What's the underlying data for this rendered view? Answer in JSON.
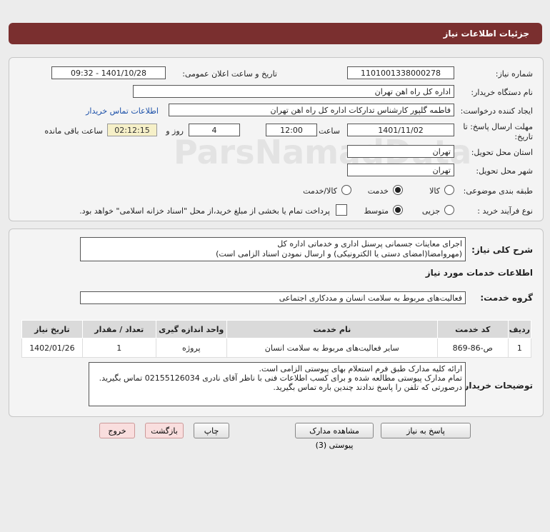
{
  "header": {
    "title": "جزئیات اطلاعات نیاز"
  },
  "form": {
    "need_number_label": "شماره نیاز:",
    "need_number": "1101001338000278",
    "announce_label": "تاریخ و ساعت اعلان عمومی:",
    "announce_value": "1401/10/28 - 09:32",
    "buyer_org_label": "نام دستگاه خریدار:",
    "buyer_org": "اداره کل راه اهن تهران",
    "creator_label": "ایجاد کننده درخواست:",
    "creator": "فاطمه گلپور کارشناس تدارکات اداره کل راه اهن تهران",
    "contact_link": "اطلاعات تماس خریدار",
    "deadline_label_1": "مهلت ارسال پاسخ: تا",
    "deadline_label_2": "تاریخ:",
    "deadline_date": "1401/11/02",
    "time_label": "ساعت",
    "deadline_time": "12:00",
    "days_value": "4",
    "days_label": "روز و",
    "remaining_time": "02:12:15",
    "remaining_label": "ساعت باقی مانده",
    "delivery_province_label": "استان محل تحویل:",
    "delivery_province": "تهران",
    "delivery_city_label": "شهر محل تحویل:",
    "delivery_city": "تهران",
    "category_label": "طبقه بندی موضوعی:",
    "category_options": [
      "کالا",
      "خدمت",
      "کالا/خدمت"
    ],
    "process_label": "نوع فرآیند خرید :",
    "process_options": [
      "جزیی",
      "متوسط"
    ],
    "payment_note": "پرداخت تمام یا بخشی از مبلغ خرید،از محل \"اسناد خزانه اسلامی\" خواهد بود."
  },
  "details": {
    "summary_label": "شرح کلی نیاز:",
    "summary_line1": "اجرای معاینات جسمانی پرسنل اداری و خدماتی اداره کل",
    "summary_line2": "(مهروامضا(امضای دستی یا الکترونیکی) و ارسال نمودن اسناد الزامی است)",
    "services_title": "اطلاعات خدمات مورد نیاز",
    "service_group_label": "گروه خدمت:",
    "service_group": "فعالیت‌های مربوط به سلامت انسان و مددکاری اجتماعی",
    "table": {
      "headers": [
        "ردیف",
        "کد خدمت",
        "نام خدمت",
        "واحد اندازه گیری",
        "تعداد / مقدار",
        "تاریخ نیاز"
      ],
      "rows": [
        [
          "1",
          "ص-86-869",
          "سایر فعالیت‌های مربوط به سلامت انسان",
          "پروژه",
          "1",
          "1402/01/26"
        ]
      ]
    },
    "buyer_notes_label": "توضیحات خریدار:",
    "buyer_notes_line1": "ارائه کلیه مدارک طبق فرم استعلام بهای پیوستی الزامی است.",
    "buyer_notes_line2": "تمام مدارک پیوستی مطالعه شده و برای کسب اطلاعات فنی با ناظر آقای نادری 02155126034 تماس بگیرید.",
    "buyer_notes_line3": "درصورتی که تلفن را پاسخ ندادند چندین باره تماس بگیرید."
  },
  "buttons": {
    "reply": "پاسخ به نیاز",
    "attachments": "مشاهده مدارک پیوستی (3)",
    "print": "چاپ",
    "back": "بازگشت",
    "exit": "خروج"
  },
  "watermark": {
    "logo_text": "ParsNamadData"
  }
}
